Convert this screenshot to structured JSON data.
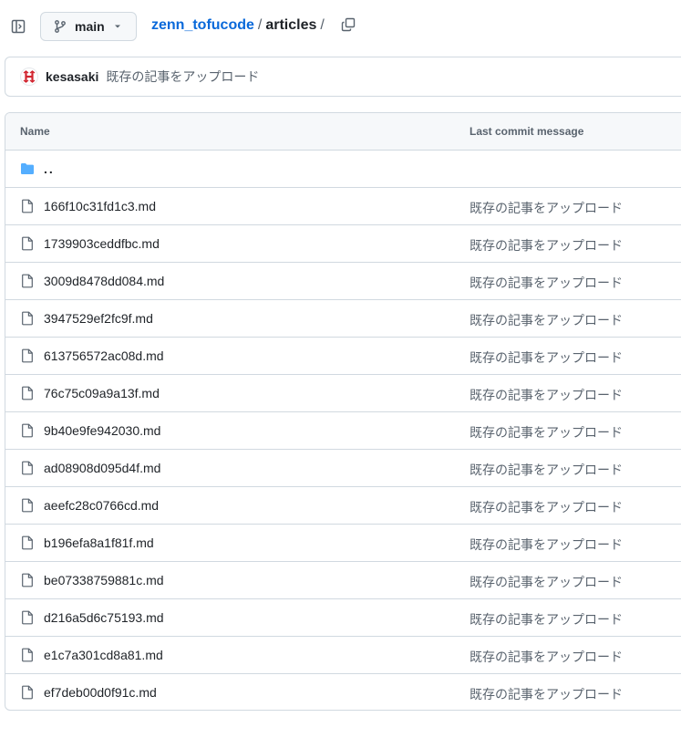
{
  "header": {
    "branch": "main",
    "repo": "zenn_tofucode",
    "separator": "/",
    "current_dir": "articles",
    "trailing_separator": "/"
  },
  "latest_commit": {
    "author": "kesasaki",
    "message": "既存の記事をアップロード"
  },
  "table": {
    "col_name": "Name",
    "col_commit": "Last commit message",
    "parent": "..",
    "rows": [
      {
        "name": "166f10c31fd1c3.md",
        "message": "既存の記事をアップロード"
      },
      {
        "name": "1739903ceddfbc.md",
        "message": "既存の記事をアップロード"
      },
      {
        "name": "3009d8478dd084.md",
        "message": "既存の記事をアップロード"
      },
      {
        "name": "3947529ef2fc9f.md",
        "message": "既存の記事をアップロード"
      },
      {
        "name": "613756572ac08d.md",
        "message": "既存の記事をアップロード"
      },
      {
        "name": "76c75c09a9a13f.md",
        "message": "既存の記事をアップロード"
      },
      {
        "name": "9b40e9fe942030.md",
        "message": "既存の記事をアップロード"
      },
      {
        "name": "ad08908d095d4f.md",
        "message": "既存の記事をアップロード"
      },
      {
        "name": "aeefc28c0766cd.md",
        "message": "既存の記事をアップロード"
      },
      {
        "name": "b196efa8a1f81f.md",
        "message": "既存の記事をアップロード"
      },
      {
        "name": "be07338759881c.md",
        "message": "既存の記事をアップロード"
      },
      {
        "name": "d216a5d6c75193.md",
        "message": "既存の記事をアップロード"
      },
      {
        "name": "e1c7a301cd8a81.md",
        "message": "既存の記事をアップロード"
      },
      {
        "name": "ef7deb00d0f91c.md",
        "message": "既存の記事をアップロード"
      }
    ]
  },
  "icons": {
    "sidebar_toggle": "sidebar-collapse-icon",
    "branch": "git-branch-icon",
    "caret": "caret-down-icon",
    "copy": "copy-icon",
    "folder": "folder-icon",
    "file": "file-icon"
  },
  "colors": {
    "link": "#0969da",
    "folder": "#54aeff",
    "muted": "#59636e",
    "border": "#d1d9e0",
    "header_bg": "#f6f8fa",
    "avatar": "#d1242f"
  }
}
